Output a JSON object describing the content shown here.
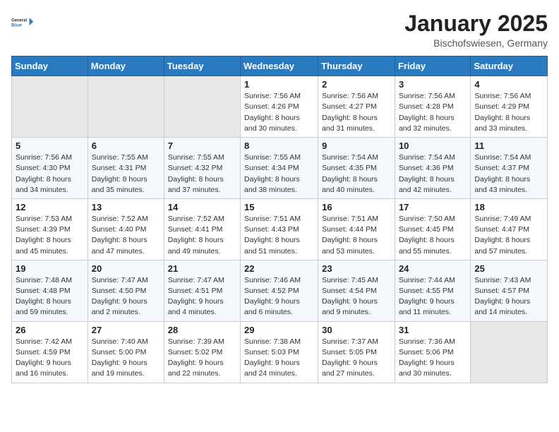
{
  "logo": {
    "general": "General",
    "blue": "Blue"
  },
  "title": "January 2025",
  "subtitle": "Bischofswiesen, Germany",
  "weekdays": [
    "Sunday",
    "Monday",
    "Tuesday",
    "Wednesday",
    "Thursday",
    "Friday",
    "Saturday"
  ],
  "weeks": [
    [
      {
        "day": "",
        "sunrise": "",
        "sunset": "",
        "daylight": "",
        "empty": true
      },
      {
        "day": "",
        "sunrise": "",
        "sunset": "",
        "daylight": "",
        "empty": true
      },
      {
        "day": "",
        "sunrise": "",
        "sunset": "",
        "daylight": "",
        "empty": true
      },
      {
        "day": "1",
        "sunrise": "Sunrise: 7:56 AM",
        "sunset": "Sunset: 4:26 PM",
        "daylight": "Daylight: 8 hours and 30 minutes."
      },
      {
        "day": "2",
        "sunrise": "Sunrise: 7:56 AM",
        "sunset": "Sunset: 4:27 PM",
        "daylight": "Daylight: 8 hours and 31 minutes."
      },
      {
        "day": "3",
        "sunrise": "Sunrise: 7:56 AM",
        "sunset": "Sunset: 4:28 PM",
        "daylight": "Daylight: 8 hours and 32 minutes."
      },
      {
        "day": "4",
        "sunrise": "Sunrise: 7:56 AM",
        "sunset": "Sunset: 4:29 PM",
        "daylight": "Daylight: 8 hours and 33 minutes."
      }
    ],
    [
      {
        "day": "5",
        "sunrise": "Sunrise: 7:56 AM",
        "sunset": "Sunset: 4:30 PM",
        "daylight": "Daylight: 8 hours and 34 minutes."
      },
      {
        "day": "6",
        "sunrise": "Sunrise: 7:55 AM",
        "sunset": "Sunset: 4:31 PM",
        "daylight": "Daylight: 8 hours and 35 minutes."
      },
      {
        "day": "7",
        "sunrise": "Sunrise: 7:55 AM",
        "sunset": "Sunset: 4:32 PM",
        "daylight": "Daylight: 8 hours and 37 minutes."
      },
      {
        "day": "8",
        "sunrise": "Sunrise: 7:55 AM",
        "sunset": "Sunset: 4:34 PM",
        "daylight": "Daylight: 8 hours and 38 minutes."
      },
      {
        "day": "9",
        "sunrise": "Sunrise: 7:54 AM",
        "sunset": "Sunset: 4:35 PM",
        "daylight": "Daylight: 8 hours and 40 minutes."
      },
      {
        "day": "10",
        "sunrise": "Sunrise: 7:54 AM",
        "sunset": "Sunset: 4:36 PM",
        "daylight": "Daylight: 8 hours and 42 minutes."
      },
      {
        "day": "11",
        "sunrise": "Sunrise: 7:54 AM",
        "sunset": "Sunset: 4:37 PM",
        "daylight": "Daylight: 8 hours and 43 minutes."
      }
    ],
    [
      {
        "day": "12",
        "sunrise": "Sunrise: 7:53 AM",
        "sunset": "Sunset: 4:39 PM",
        "daylight": "Daylight: 8 hours and 45 minutes."
      },
      {
        "day": "13",
        "sunrise": "Sunrise: 7:52 AM",
        "sunset": "Sunset: 4:40 PM",
        "daylight": "Daylight: 8 hours and 47 minutes."
      },
      {
        "day": "14",
        "sunrise": "Sunrise: 7:52 AM",
        "sunset": "Sunset: 4:41 PM",
        "daylight": "Daylight: 8 hours and 49 minutes."
      },
      {
        "day": "15",
        "sunrise": "Sunrise: 7:51 AM",
        "sunset": "Sunset: 4:43 PM",
        "daylight": "Daylight: 8 hours and 51 minutes."
      },
      {
        "day": "16",
        "sunrise": "Sunrise: 7:51 AM",
        "sunset": "Sunset: 4:44 PM",
        "daylight": "Daylight: 8 hours and 53 minutes."
      },
      {
        "day": "17",
        "sunrise": "Sunrise: 7:50 AM",
        "sunset": "Sunset: 4:45 PM",
        "daylight": "Daylight: 8 hours and 55 minutes."
      },
      {
        "day": "18",
        "sunrise": "Sunrise: 7:49 AM",
        "sunset": "Sunset: 4:47 PM",
        "daylight": "Daylight: 8 hours and 57 minutes."
      }
    ],
    [
      {
        "day": "19",
        "sunrise": "Sunrise: 7:48 AM",
        "sunset": "Sunset: 4:48 PM",
        "daylight": "Daylight: 8 hours and 59 minutes."
      },
      {
        "day": "20",
        "sunrise": "Sunrise: 7:47 AM",
        "sunset": "Sunset: 4:50 PM",
        "daylight": "Daylight: 9 hours and 2 minutes."
      },
      {
        "day": "21",
        "sunrise": "Sunrise: 7:47 AM",
        "sunset": "Sunset: 4:51 PM",
        "daylight": "Daylight: 9 hours and 4 minutes."
      },
      {
        "day": "22",
        "sunrise": "Sunrise: 7:46 AM",
        "sunset": "Sunset: 4:52 PM",
        "daylight": "Daylight: 9 hours and 6 minutes."
      },
      {
        "day": "23",
        "sunrise": "Sunrise: 7:45 AM",
        "sunset": "Sunset: 4:54 PM",
        "daylight": "Daylight: 9 hours and 9 minutes."
      },
      {
        "day": "24",
        "sunrise": "Sunrise: 7:44 AM",
        "sunset": "Sunset: 4:55 PM",
        "daylight": "Daylight: 9 hours and 11 minutes."
      },
      {
        "day": "25",
        "sunrise": "Sunrise: 7:43 AM",
        "sunset": "Sunset: 4:57 PM",
        "daylight": "Daylight: 9 hours and 14 minutes."
      }
    ],
    [
      {
        "day": "26",
        "sunrise": "Sunrise: 7:42 AM",
        "sunset": "Sunset: 4:59 PM",
        "daylight": "Daylight: 9 hours and 16 minutes."
      },
      {
        "day": "27",
        "sunrise": "Sunrise: 7:40 AM",
        "sunset": "Sunset: 5:00 PM",
        "daylight": "Daylight: 9 hours and 19 minutes."
      },
      {
        "day": "28",
        "sunrise": "Sunrise: 7:39 AM",
        "sunset": "Sunset: 5:02 PM",
        "daylight": "Daylight: 9 hours and 22 minutes."
      },
      {
        "day": "29",
        "sunrise": "Sunrise: 7:38 AM",
        "sunset": "Sunset: 5:03 PM",
        "daylight": "Daylight: 9 hours and 24 minutes."
      },
      {
        "day": "30",
        "sunrise": "Sunrise: 7:37 AM",
        "sunset": "Sunset: 5:05 PM",
        "daylight": "Daylight: 9 hours and 27 minutes."
      },
      {
        "day": "31",
        "sunrise": "Sunrise: 7:36 AM",
        "sunset": "Sunset: 5:06 PM",
        "daylight": "Daylight: 9 hours and 30 minutes."
      },
      {
        "day": "",
        "sunrise": "",
        "sunset": "",
        "daylight": "",
        "empty": true
      }
    ]
  ]
}
